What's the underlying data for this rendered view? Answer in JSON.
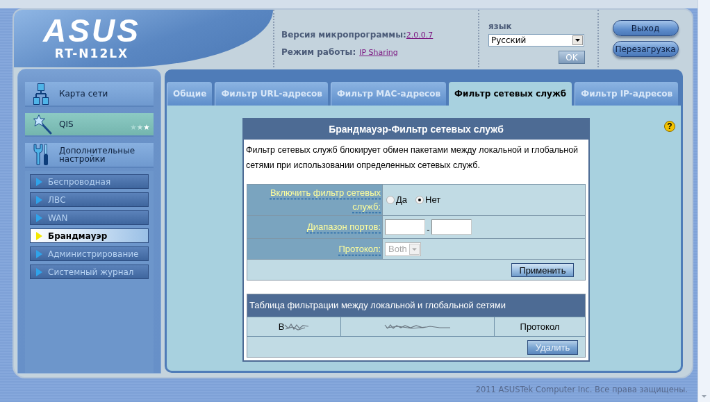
{
  "header": {
    "logo": "ASUS",
    "model": "RT-N12LX",
    "firmware_label": "Версия микропрограммы:",
    "firmware_version": "2.0.0.7",
    "mode_label": "Режим работы:",
    "mode_value": "IP Sharing",
    "language_label": "язык",
    "language_value": "Русский",
    "language_ok": "OK",
    "buttons": [
      "Выход",
      "Перезагрузка"
    ]
  },
  "sidebar": {
    "items": [
      {
        "label": "Карта сети",
        "kind": "network"
      },
      {
        "label": "QIS",
        "kind": "wizard"
      },
      {
        "label": "Дополнительные настройки",
        "kind": "tools"
      }
    ],
    "submenu": [
      {
        "label": "Беспроводная",
        "selected": false
      },
      {
        "label": "ЛВС",
        "selected": false
      },
      {
        "label": "WAN",
        "selected": false
      },
      {
        "label": "Брандмауэр",
        "selected": true
      },
      {
        "label": "Администрирование",
        "selected": false
      },
      {
        "label": "Системный журнал",
        "selected": false
      }
    ]
  },
  "tabs": [
    {
      "label": "Общие",
      "selected": false
    },
    {
      "label": "Фильтр URL-адресов",
      "selected": false
    },
    {
      "label": "Фильтр MAC-адресов",
      "selected": false
    },
    {
      "label": "Фильтр сетевых служб",
      "selected": true
    },
    {
      "label": "Фильтр IP-адресов",
      "selected": false
    }
  ],
  "help_button": "?",
  "form": {
    "title": "Брандмауэр-Фильтр сетевых служб",
    "description": "Фильтр сетевых служб блокирует обмен пакетами между локальной и глобальной сетями при использовании определенных сетевых служб.",
    "fields": [
      {
        "kind": "radio",
        "label": "Включить фильтр сетевых служб:",
        "options": [
          {
            "label": "Да",
            "selected": false
          },
          {
            "label": "Нет",
            "selected": true
          }
        ]
      },
      {
        "kind": "range",
        "label": "Диапазон портов:",
        "separator": "-"
      },
      {
        "kind": "select",
        "label": "Протокол:",
        "value": "Both",
        "disabled": true
      }
    ],
    "apply_button": "Применить"
  },
  "filter_table": {
    "title": "Таблица фильтрации между локальной и глобальной сетями",
    "columns": [
      {
        "label": "В",
        "smudged": true
      },
      {
        "smudged": true
      },
      {
        "label": "Протокол",
        "smudged": false
      }
    ],
    "delete_button": "Удалить"
  },
  "footer": "2011 ASUSTek Computer Inc. Все права защищены."
}
